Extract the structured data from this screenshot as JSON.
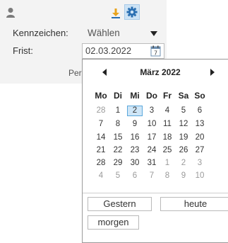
{
  "form": {
    "kennzeichen_label": "Kennzeichen:",
    "kennzeichen_value": "Wählen",
    "frist_label": "Frist:",
    "frist_value": "02.03.2022",
    "partial_text": "Per"
  },
  "icons": {
    "user": "user-icon",
    "download": "download-icon",
    "settings": "gear-icon",
    "calendar": "calendar-icon"
  },
  "calendar": {
    "month_title": "März 2022",
    "weekdays": [
      "Mo",
      "Di",
      "Mi",
      "Do",
      "Fr",
      "Sa",
      "So"
    ],
    "selected_day": "2",
    "weeks": [
      [
        "28",
        "1",
        "2",
        "3",
        "4",
        "5",
        "6"
      ],
      [
        "7",
        "8",
        "9",
        "10",
        "11",
        "12",
        "13"
      ],
      [
        "14",
        "15",
        "16",
        "17",
        "18",
        "19",
        "20"
      ],
      [
        "21",
        "22",
        "23",
        "24",
        "25",
        "26",
        "27"
      ],
      [
        "28",
        "29",
        "30",
        "31",
        "1",
        "2",
        "3"
      ],
      [
        "4",
        "5",
        "6",
        "7",
        "8",
        "9",
        "10"
      ]
    ],
    "buttons": {
      "yesterday": "Gestern",
      "today": "heute",
      "tomorrow": "morgen"
    }
  },
  "colors": {
    "selection_fill": "#cfe6f7",
    "selection_border": "#5aa8dc",
    "panel_bg": "#f3f3f3"
  }
}
